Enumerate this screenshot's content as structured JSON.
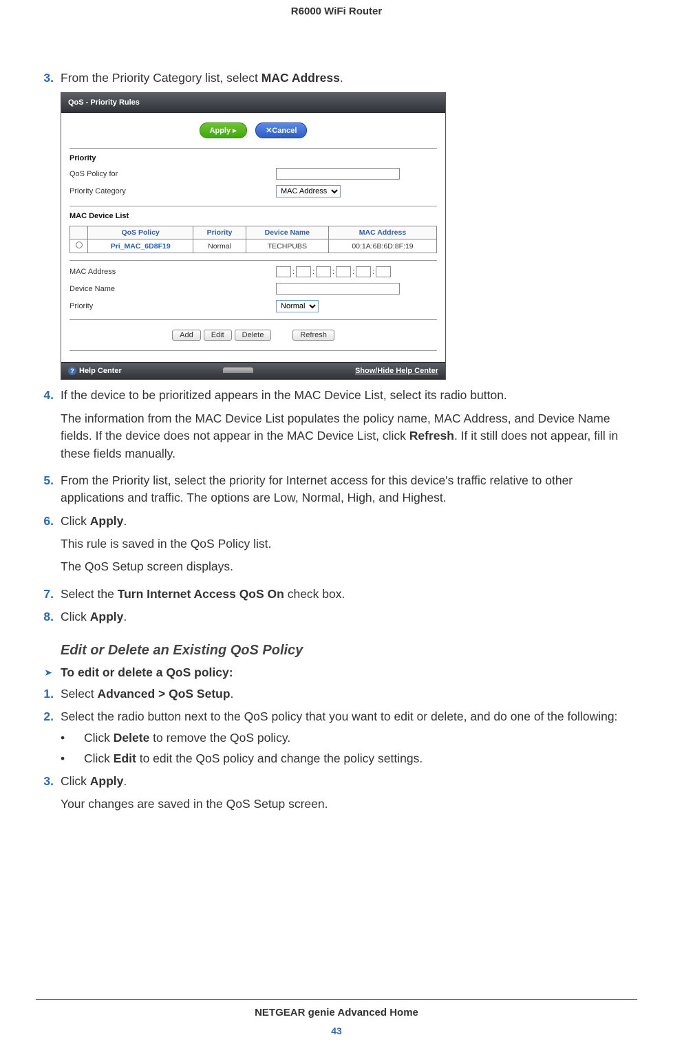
{
  "header": {
    "title": "R6000 WiFi Router"
  },
  "steps": {
    "s3": {
      "num": "3.",
      "text_a": "From the Priority Category list, select ",
      "bold": "MAC Address",
      "text_b": "."
    },
    "s4": {
      "num": "4.",
      "line1": "If the device to be prioritized appears in the MAC Device List, select its radio button.",
      "para_a": "The information from the MAC Device List populates the policy name, MAC Address, and Device Name fields. If the device does not appear in the MAC Device List, click ",
      "para_bold": "Refresh",
      "para_b": ". If it still does not appear, fill in these fields manually."
    },
    "s5": {
      "num": "5.",
      "text": "From the Priority list, select the priority for Internet access for this device's traffic relative to other applications and traffic. The options are Low, Normal, High, and Highest."
    },
    "s6": {
      "num": "6.",
      "text_a": "Click ",
      "bold": "Apply",
      "text_b": ".",
      "p1": "This rule is saved in the QoS Policy list.",
      "p2": "The QoS Setup screen displays."
    },
    "s7": {
      "num": "7.",
      "text_a": "Select the ",
      "bold": "Turn Internet Access QoS On",
      "text_b": " check box."
    },
    "s8": {
      "num": "8.",
      "text_a": "Click ",
      "bold": "Apply",
      "text_b": "."
    }
  },
  "subhead": "Edit or Delete an Existing QoS Policy",
  "arrow_heading": "To edit or delete a QoS policy:",
  "edit_steps": {
    "e1": {
      "num": "1.",
      "text_a": "Select ",
      "bold": "Advanced > QoS Setup",
      "text_b": "."
    },
    "e2": {
      "num": "2.",
      "text": "Select the radio button next to the QoS policy that you want to edit or delete, and do one of the following:"
    },
    "b1": {
      "bullet": "•",
      "text_a": "Click ",
      "bold": "Delete",
      "text_b": " to remove the QoS policy."
    },
    "b2": {
      "bullet": "•",
      "text_a": "Click ",
      "bold": "Edit",
      "text_b": " to edit the QoS policy and change the policy settings."
    },
    "e3": {
      "num": "3.",
      "text_a": "Click ",
      "bold": "Apply",
      "text_b": ".",
      "p1": "Your changes are saved in the QoS Setup screen."
    }
  },
  "screenshot": {
    "title": "QoS - Priority Rules",
    "apply": "Apply ▸",
    "cancel": "✕Cancel",
    "section_priority": "Priority",
    "qos_policy_for": "QoS Policy for",
    "priority_category": "Priority Category",
    "priority_category_val": "MAC Address",
    "section_mac_list": "MAC Device List",
    "th1": "QoS Policy",
    "th2": "Priority",
    "th3": "Device Name",
    "th4": "MAC Address",
    "row_policy": "Pri_MAC_6D8F19",
    "row_priority": "Normal",
    "row_device": "TECHPUBS",
    "row_mac": "00:1A:6B:6D:8F:19",
    "mac_address": "MAC Address",
    "device_name": "Device Name",
    "priority_label": "Priority",
    "priority_val": "Normal",
    "btn_add": "Add",
    "btn_edit": "Edit",
    "btn_delete": "Delete",
    "btn_refresh": "Refresh",
    "help_center": "Help Center",
    "show_hide": "Show/Hide Help Center"
  },
  "footer": {
    "text": "NETGEAR genie Advanced Home",
    "page": "43"
  }
}
